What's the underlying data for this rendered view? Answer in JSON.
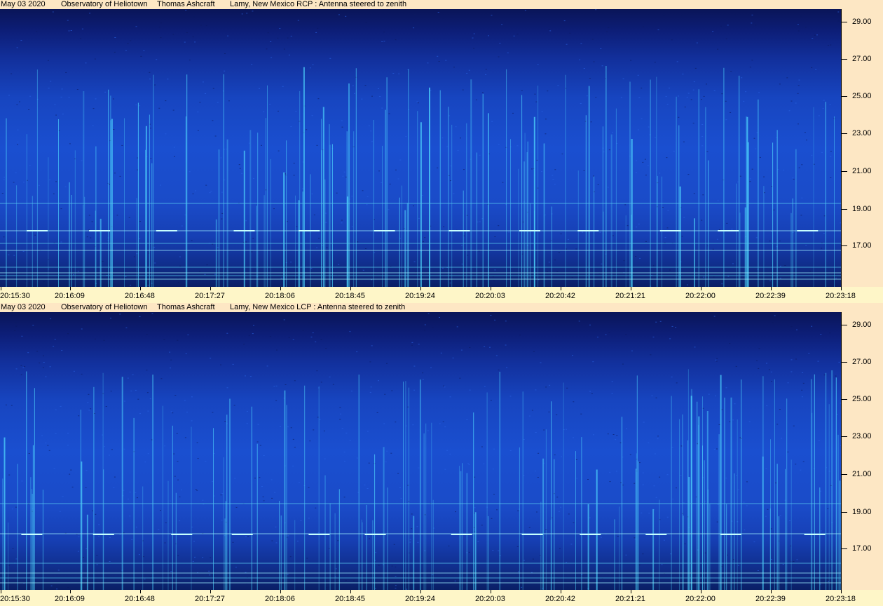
{
  "panels": [
    {
      "header": {
        "date": "May 03  2020",
        "observatory": "Observatory of Heliotown",
        "observer": "Thomas Ashcraft",
        "location": "Lamy, New Mexico  RCP  :  Antenna steered to zenith"
      }
    },
    {
      "header": {
        "date": "May 03  2020",
        "observatory": "Observatory of Heliotown",
        "observer": "Thomas Ashcraft",
        "location": "Lamy, New Mexico  LCP  :  Antenna steered to zenith"
      }
    }
  ],
  "freq_labels": [
    "29.00",
    "27.00",
    "25.00",
    "23.00",
    "21.00",
    "19.00",
    "17.00"
  ],
  "time_labels": [
    "20:15:30",
    "20:16:09",
    "20:16:48",
    "20:17:27",
    "20:18:06",
    "20:18:45",
    "20:19:24",
    "20:20:03",
    "20:20:42",
    "20:21:21",
    "20:22:00",
    "20:22:39",
    "20:23:18"
  ],
  "colors": {
    "background": "#fde7c4",
    "time_axis_bg": "#fef6c8",
    "spectrogram_dark": "#0a1558",
    "spectrogram_mid": "#1a4fd0",
    "burst_cyan": "#4fd8ff"
  }
}
